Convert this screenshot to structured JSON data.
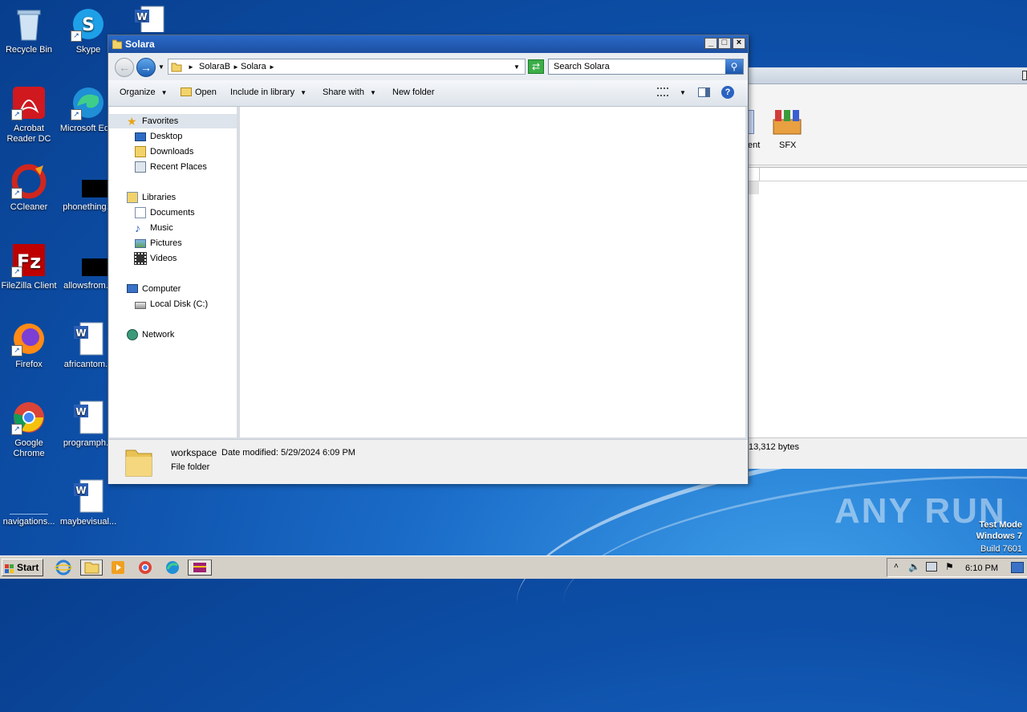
{
  "desktop": {
    "icons": [
      {
        "label": "Recycle Bin"
      },
      {
        "label": "Skype"
      },
      {
        "label": "Acrobat Reader DC"
      },
      {
        "label": "Microsoft Ed..."
      },
      {
        "label": "CCleaner"
      },
      {
        "label": "phonething..."
      },
      {
        "label": "FileZilla Client"
      },
      {
        "label": "allowsfrom..."
      },
      {
        "label": "Firefox"
      },
      {
        "label": "africantom..."
      },
      {
        "label": "Google Chrome"
      },
      {
        "label": "programph..."
      },
      {
        "label": "navigations..."
      },
      {
        "label": "maybevisual..."
      }
    ]
  },
  "background_window": {
    "toolbar_items": [
      {
        "label": "ent"
      },
      {
        "label": "SFX"
      }
    ],
    "status": "13,312 bytes"
  },
  "explorer": {
    "title": "Solara",
    "address": {
      "crumbs": [
        "SolaraB",
        "Solara"
      ]
    },
    "search": {
      "placeholder": "Search Solara"
    },
    "commands": {
      "organize": "Organize",
      "open": "Open",
      "include_in_library": "Include in library",
      "share_with": "Share with",
      "new_folder": "New folder"
    },
    "nav": {
      "favorites": "Favorites",
      "desktop": "Desktop",
      "downloads": "Downloads",
      "recent_places": "Recent Places",
      "libraries": "Libraries",
      "documents": "Documents",
      "music": "Music",
      "pictures": "Pictures",
      "videos": "Videos",
      "computer": "Computer",
      "local_disk": "Local Disk (C:)",
      "network": "Network"
    },
    "details": {
      "name": "workspace",
      "date_label": "Date modified:",
      "date_value": "5/29/2024 6:09 PM",
      "type": "File folder"
    }
  },
  "watermark": {
    "brand": "ANY RUN",
    "mode": "Test Mode",
    "os": "Windows 7",
    "build": "Build 7601"
  },
  "taskbar": {
    "start_label": "Start",
    "clock": "6:10 PM"
  }
}
